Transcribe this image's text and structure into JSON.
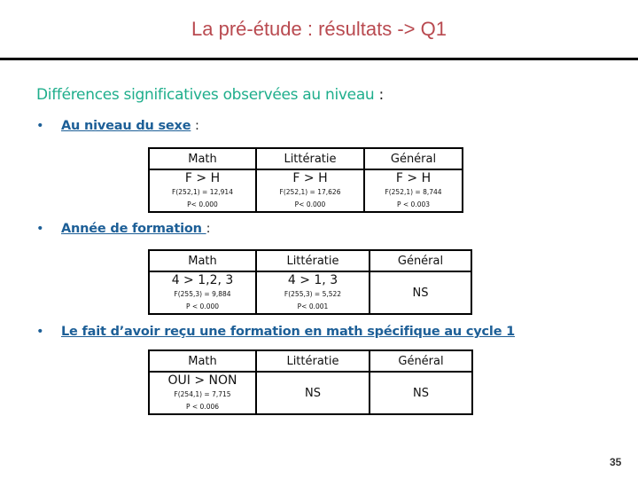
{
  "title": "La pré-étude : résultats -> Q1",
  "heading": {
    "text": "Différences significatives observées au niveau",
    "colon": " :"
  },
  "sections": [
    {
      "bullet": "•",
      "label": "Au niveau du sexe",
      "colon": " :",
      "columns": [
        "Math",
        "Littératie",
        "Général"
      ],
      "cells": [
        {
          "result": "F > H",
          "stat": "F(252,1) = 12,914",
          "p": "P< 0.000"
        },
        {
          "result": "F > H",
          "stat": "F(252,1) = 17,626",
          "p": "P< 0.000"
        },
        {
          "result": "F > H",
          "stat": "F(252,1) = 8,744",
          "p": "P < 0.003"
        }
      ]
    },
    {
      "bullet": "•",
      "label": "Année de formation ",
      "colon": ":",
      "columns": [
        "Math",
        "Littératie",
        "Général"
      ],
      "cells": [
        {
          "result": "4 > 1,2, 3",
          "stat": "F(255,3) = 9,884",
          "p": "P < 0.000"
        },
        {
          "result": "4 > 1, 3",
          "stat": "F(255,3) = 5,522",
          "p": "P< 0.001"
        },
        {
          "result": "NS"
        }
      ]
    },
    {
      "bullet": "•",
      "label": "Le fait d’avoir reçu une formation en math spécifique au cycle 1",
      "colon": "",
      "columns": [
        "Math",
        "Littératie",
        "Général"
      ],
      "cells": [
        {
          "result": "OUI  > NON",
          "stat": "F(254,1) = 7,715",
          "p": "P < 0.006"
        },
        {
          "result": "NS"
        },
        {
          "result": "NS"
        }
      ]
    }
  ],
  "page_number": "35"
}
